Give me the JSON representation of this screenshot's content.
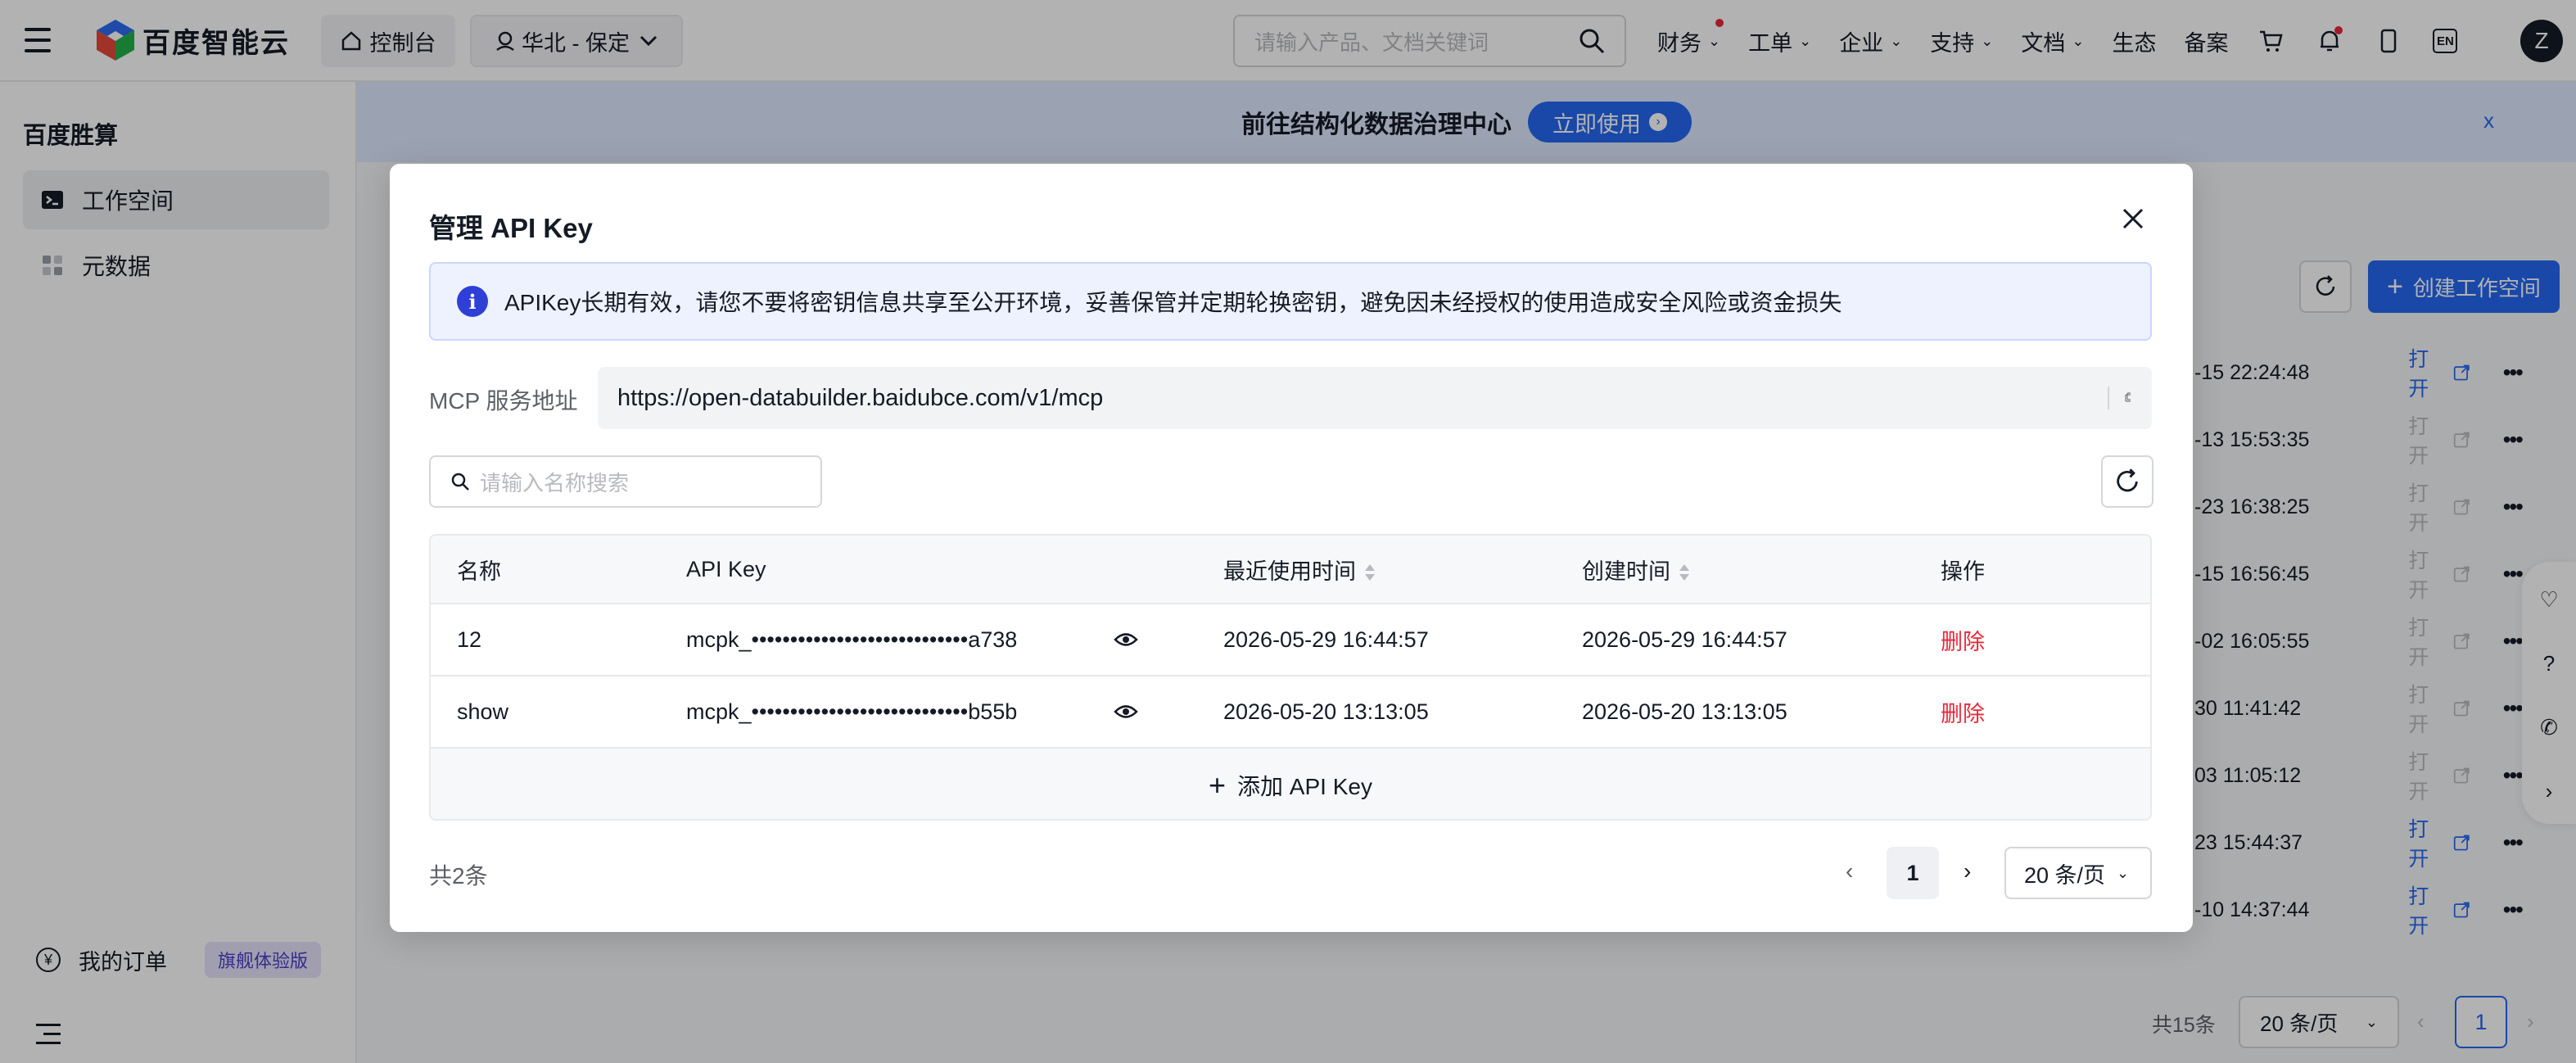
{
  "topnav": {
    "logo_text": "百度智能云",
    "console_label": "控制台",
    "region_label": "华北 - 保定",
    "search_placeholder": "请输入产品、文档关键词",
    "items": [
      {
        "label": "财务",
        "dot": true
      },
      {
        "label": "工单",
        "dot": false
      },
      {
        "label": "企业",
        "dot": false
      },
      {
        "label": "支持",
        "dot": false
      },
      {
        "label": "文档",
        "dot": false
      },
      {
        "label": "生态"
      },
      {
        "label": "备案"
      }
    ],
    "lang_label": "EN",
    "avatar_letter": "Z"
  },
  "sidebar": {
    "title": "百度胜算",
    "items": [
      {
        "label": "工作空间",
        "active": true,
        "icon": "terminal-icon"
      },
      {
        "label": "元数据",
        "active": false,
        "icon": "grid-icon"
      }
    ],
    "order_label": "我的订单",
    "order_coin": "¥",
    "order_badge": "旗舰体验版"
  },
  "banner": {
    "text": "前往结构化数据治理中心",
    "button_label": "立即使用",
    "close_label": "x"
  },
  "background": {
    "create_label": "创建工作空间",
    "rows": [
      {
        "time": "-15 22:24:48",
        "open": "打开",
        "enabled": true
      },
      {
        "time": "-13 15:53:35",
        "open": "打开",
        "enabled": false
      },
      {
        "time": "-23 16:38:25",
        "open": "打开",
        "enabled": false
      },
      {
        "time": "-15 16:56:45",
        "open": "打开",
        "enabled": false
      },
      {
        "time": "-02 16:05:55",
        "open": "打开",
        "enabled": false
      },
      {
        "time": "30 11:41:42",
        "open": "打开",
        "enabled": false
      },
      {
        "time": "03 11:05:12",
        "open": "打开",
        "enabled": false
      },
      {
        "time": "23 15:44:37",
        "open": "打开",
        "enabled": true
      },
      {
        "time": "-10 14:37:44",
        "open": "打开",
        "enabled": true
      }
    ],
    "footer_total": "共15条",
    "footer_size": "20 条/页",
    "footer_page": "1"
  },
  "modal": {
    "title": "管理 API Key",
    "alert": "APIKey长期有效，请您不要将密钥信息共享至公开环境，妥善保管并定期轮换密钥，避免因未经授权的使用造成安全风险或资金损失",
    "mcp_label": "MCP 服务地址",
    "mcp_url": "https://open-databuilder.baidubce.com/v1/mcp",
    "search_placeholder": "请输入名称搜索",
    "columns": {
      "name": "名称",
      "key": "API Key",
      "last_used": "最近使用时间",
      "created": "创建时间",
      "action": "操作"
    },
    "rows": [
      {
        "name": "12",
        "key": "mcpk_••••••••••••••••••••••••••••a738",
        "last_used": "2026-05-29 16:44:57",
        "created": "2026-05-29 16:44:57",
        "action": "删除"
      },
      {
        "name": "show",
        "key": "mcpk_••••••••••••••••••••••••••••b55b",
        "last_used": "2026-05-20 13:13:05",
        "created": "2026-05-20 13:13:05",
        "action": "删除"
      }
    ],
    "add_label": "添加 API Key",
    "total": "共2条",
    "page": "1",
    "page_size": "20 条/页"
  },
  "colors": {
    "primary": "#2468f2",
    "danger": "#e8283c",
    "info": "#2e3fd8"
  }
}
